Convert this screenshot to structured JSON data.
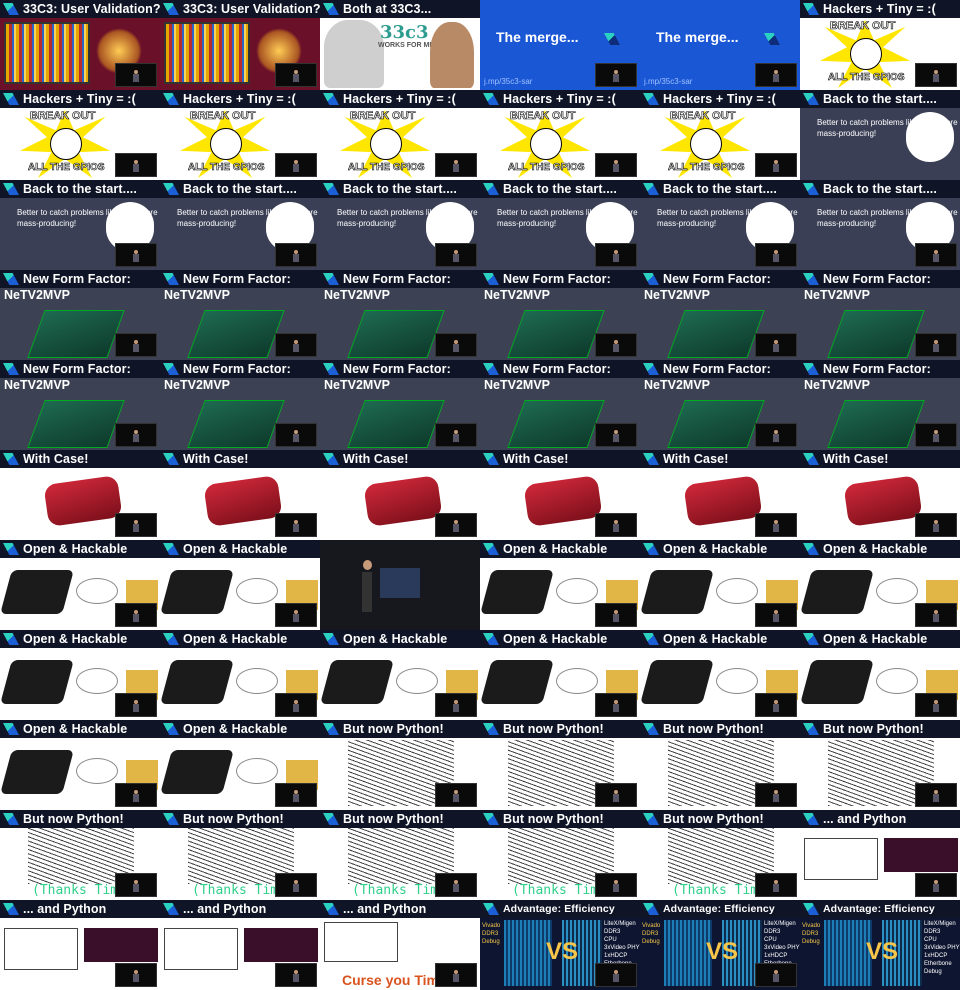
{
  "tiles": [
    {
      "type": "validation",
      "title": "33C3: User Validation?",
      "cam": true
    },
    {
      "type": "validation",
      "title": "33C3: User Validation?",
      "cam": true
    },
    {
      "type": "both",
      "title": "Both at 33C3...",
      "logo": "33c3",
      "logo_sub": "WORKS FOR ME",
      "cam": false
    },
    {
      "type": "merge",
      "merge_text": "The merge...",
      "url": "j.mp/35c3-sar",
      "cam": true
    },
    {
      "type": "merge",
      "merge_text": "The merge...",
      "url": "j.mp/35c3-sar",
      "cam": true
    },
    {
      "type": "gpio",
      "title": "Hackers + Tiny  = :(",
      "top": "BREAK OUT",
      "bottom": "ALL THE GPIOS",
      "cam": true
    },
    {
      "type": "gpio",
      "title": "Hackers + Tiny  = :(",
      "top": "BREAK OUT",
      "bottom": "ALL THE GPIOS",
      "cam": true
    },
    {
      "type": "gpio",
      "title": "Hackers + Tiny  = :(",
      "top": "BREAK OUT",
      "bottom": "ALL THE GPIOS",
      "cam": true
    },
    {
      "type": "gpio",
      "title": "Hackers + Tiny  = :(",
      "top": "BREAK OUT",
      "bottom": "ALL THE GPIOS",
      "cam": true
    },
    {
      "type": "gpio",
      "title": "Hackers + Tiny  = :(",
      "top": "BREAK OUT",
      "bottom": "ALL THE GPIOS",
      "cam": true
    },
    {
      "type": "gpio",
      "title": "Hackers + Tiny  = :(",
      "top": "BREAK OUT",
      "bottom": "ALL THE GPIOS",
      "cam": true
    },
    {
      "type": "start",
      "title": "Back to the start....",
      "note": "Better to catch problems like this before mass-producing!",
      "cam": false
    },
    {
      "type": "start",
      "title": "Back to the start....",
      "note": "Better to catch problems like this before mass-producing!",
      "cam": true
    },
    {
      "type": "start",
      "title": "Back to the start....",
      "note": "Better to catch problems like this before mass-producing!",
      "cam": true
    },
    {
      "type": "start",
      "title": "Back to the start....",
      "note": "Better to catch problems like this before mass-producing!",
      "cam": true
    },
    {
      "type": "start",
      "title": "Back to the start....",
      "note": "Better to catch problems like this before mass-producing!",
      "cam": true
    },
    {
      "type": "start",
      "title": "Back to the start....",
      "note": "Better to catch problems like this before mass-producing!",
      "cam": true
    },
    {
      "type": "start",
      "title": "Back to the start....",
      "note": "Better to catch problems like this before mass-producing!",
      "cam": true
    },
    {
      "type": "form",
      "title": "New Form Factor:",
      "sub": "NeTV2MVP",
      "cam": true
    },
    {
      "type": "form",
      "title": "New Form Factor:",
      "sub": "NeTV2MVP",
      "cam": true
    },
    {
      "type": "form",
      "title": "New Form Factor:",
      "sub": "NeTV2MVP",
      "cam": true
    },
    {
      "type": "form",
      "title": "New Form Factor:",
      "sub": "NeTV2MVP",
      "cam": true
    },
    {
      "type": "form",
      "title": "New Form Factor:",
      "sub": "NeTV2MVP",
      "cam": true
    },
    {
      "type": "form",
      "title": "New Form Factor:",
      "sub": "NeTV2MVP",
      "cam": true
    },
    {
      "type": "form",
      "title": "New Form Factor:",
      "sub": "NeTV2MVP",
      "cam": true
    },
    {
      "type": "form",
      "title": "New Form Factor:",
      "sub": "NeTV2MVP",
      "cam": true
    },
    {
      "type": "form",
      "title": "New Form Factor:",
      "sub": "NeTV2MVP",
      "cam": true
    },
    {
      "type": "form",
      "title": "New Form Factor:",
      "sub": "NeTV2MVP",
      "cam": true
    },
    {
      "type": "form",
      "title": "New Form Factor:",
      "sub": "NeTV2MVP",
      "cam": true
    },
    {
      "type": "form",
      "title": "New Form Factor:",
      "sub": "NeTV2MVP",
      "cam": true
    },
    {
      "type": "case",
      "title": "With Case!",
      "cam": true
    },
    {
      "type": "case",
      "title": "With Case!",
      "cam": true
    },
    {
      "type": "case",
      "title": "With Case!",
      "cam": true
    },
    {
      "type": "case",
      "title": "With Case!",
      "cam": true
    },
    {
      "type": "case",
      "title": "With Case!",
      "cam": true
    },
    {
      "type": "case",
      "title": "With Case!",
      "cam": true
    },
    {
      "type": "hack",
      "title": "Open & Hackable",
      "cam": true
    },
    {
      "type": "hack",
      "title": "Open & Hackable",
      "cam": true
    },
    {
      "type": "stage",
      "cam": false
    },
    {
      "type": "hack",
      "title": "Open & Hackable",
      "cam": true
    },
    {
      "type": "hack",
      "title": "Open & Hackable",
      "cam": true
    },
    {
      "type": "hack",
      "title": "Open & Hackable",
      "cam": true
    },
    {
      "type": "hack",
      "title": "Open & Hackable",
      "cam": true
    },
    {
      "type": "hack",
      "title": "Open & Hackable",
      "cam": true
    },
    {
      "type": "hack",
      "title": "Open & Hackable",
      "cam": true
    },
    {
      "type": "hack",
      "title": "Open & Hackable",
      "cam": true
    },
    {
      "type": "hack",
      "title": "Open & Hackable",
      "cam": true
    },
    {
      "type": "hack",
      "title": "Open & Hackable",
      "cam": true
    },
    {
      "type": "hack",
      "title": "Open & Hackable",
      "cam": true
    },
    {
      "type": "hack",
      "title": "Open & Hackable",
      "cam": true
    },
    {
      "type": "python",
      "title": "But now Python!",
      "cam": true
    },
    {
      "type": "python",
      "title": "But now Python!",
      "cam": true
    },
    {
      "type": "python",
      "title": "But now Python!",
      "cam": true
    },
    {
      "type": "python",
      "title": "But now Python!",
      "cam": true
    },
    {
      "type": "thanks",
      "title": "But now Python!",
      "caption": "(Thanks Tim",
      "cam": true
    },
    {
      "type": "thanks",
      "title": "But now Python!",
      "caption": "(Thanks Tim",
      "cam": true
    },
    {
      "type": "thanks",
      "title": "But now Python!",
      "caption": "(Thanks Tim",
      "cam": true
    },
    {
      "type": "thanks",
      "title": "But now Python!",
      "caption": "(Thanks Tim",
      "cam": true
    },
    {
      "type": "thanks",
      "title": "But now Python!",
      "caption": "(Thanks Tim",
      "cam": true
    },
    {
      "type": "andpy",
      "title": "... and Python",
      "cam": true
    },
    {
      "type": "andpy",
      "title": "... and Python",
      "cam": true
    },
    {
      "type": "andpy",
      "title": "... and Python",
      "cam": true
    },
    {
      "type": "curse",
      "title": "... and Python",
      "caption": "Curse you Tim",
      "cam": true
    },
    {
      "type": "eff",
      "title": "Advantage: Efficiency",
      "left_spec": "Vivado\nDDR3\nDebug",
      "right_spec": "LiteX/Migen\nDDR3\nCPU\n3xVideo PHY\n1xHDCP\nEtherbone\nDebug",
      "vs": "VS",
      "cam": true
    },
    {
      "type": "eff",
      "title": "Advantage: Efficiency",
      "left_spec": "Vivado\nDDR3\nDebug",
      "right_spec": "LiteX/Migen\nDDR3\nCPU\n3xVideo PHY\n1xHDCP\nEtherbone\nDebug",
      "vs": "VS",
      "cam": true
    },
    {
      "type": "eff",
      "title": "Advantage: Efficiency",
      "left_spec": "Vivado\nDDR3\nDebug",
      "right_spec": "LiteX/Migen\nDDR3\nCPU\n3xVideo PHY\n1xHDCP\nEtherbone\nDebug",
      "vs": "VS",
      "cam": false
    }
  ]
}
